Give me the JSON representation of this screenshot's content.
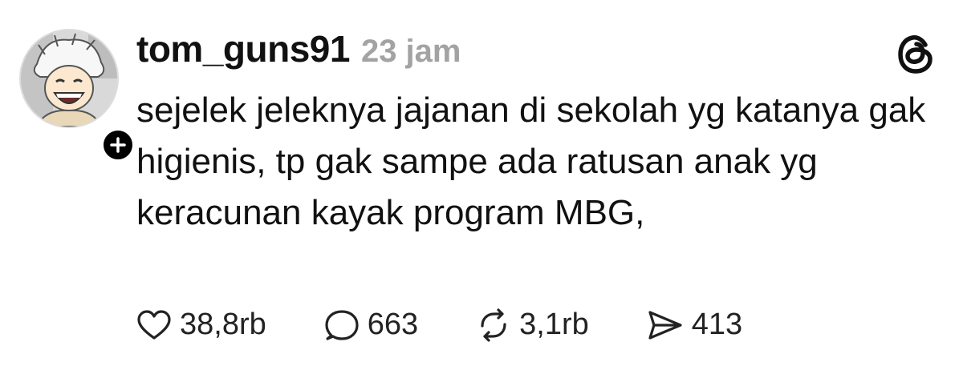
{
  "post": {
    "author": {
      "username": "tom_guns91",
      "avatar_icon": "anime-avatar-icon"
    },
    "time": "23 jam",
    "text": "sejelek jeleknya jajanan di sekolah yg katanya gak higienis, tp gak sampe ada ratusan anak yg keracunan kayak program MBG,",
    "actions": {
      "likes": "38,8rb",
      "replies": "663",
      "reposts": "3,1rb",
      "shares": "413"
    }
  },
  "icons": {
    "follow": "plus-icon",
    "logo": "threads-logo-icon",
    "like": "heart-icon",
    "reply": "comment-icon",
    "repost": "repost-icon",
    "share": "send-icon"
  },
  "colors": {
    "text": "#111111",
    "muted": "#a3a3a3",
    "background": "#ffffff"
  }
}
